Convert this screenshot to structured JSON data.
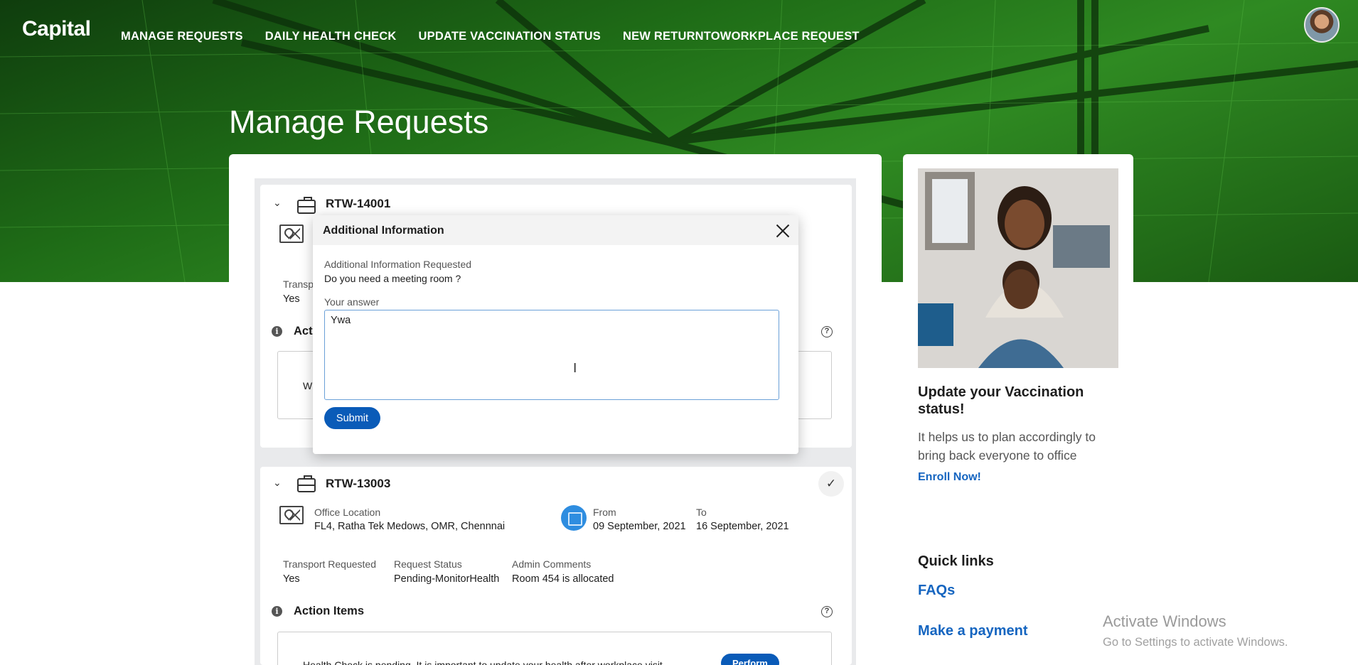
{
  "brand": {
    "logo": "Capital"
  },
  "nav": {
    "items": [
      "MANAGE REQUESTS",
      "DAILY HEALTH CHECK",
      "UPDATE VACCINATION STATUS",
      "NEW RETURNTOWORKPLACE REQUEST"
    ]
  },
  "page": {
    "title": "Manage Requests"
  },
  "requests": [
    {
      "id": "RTW-14001",
      "transport_label_partial": "Transp",
      "transport_value": "Yes",
      "action_items_partial": "Act",
      "action_text_partial": "W"
    },
    {
      "id": "RTW-13003",
      "office_location_label": "Office Location",
      "office_location": "FL4, Ratha Tek Medows, OMR, Chennnai",
      "from_label": "From",
      "from_date": "09 September, 2021",
      "to_label": "To",
      "to_date": "16 September, 2021",
      "transport_label": "Transport Requested",
      "transport_value": "Yes",
      "status_label": "Request Status",
      "status_value": "Pending-MonitorHealth",
      "admin_label": "Admin Comments",
      "admin_value": "Room 454 is allocated",
      "action_items_title": "Action Items",
      "health_text": "Health Check is pending. It is important to update your health after workplace visit",
      "perform_label": "Perform"
    }
  ],
  "modal": {
    "title": "Additional Information",
    "requested_label": "Additional Information Requested",
    "question": "Do you need a meeting room ?",
    "answer_label": "Your answer",
    "answer_value": "Ywa",
    "submit_label": "Submit"
  },
  "vaccination": {
    "title": "Update your Vaccination status!",
    "text": "It helps us to plan accordingly to bring back everyone to office",
    "link": "Enroll Now!"
  },
  "quick_links": {
    "title": "Quick links",
    "items": [
      "FAQs",
      "Make a payment"
    ]
  },
  "os_watermark": {
    "line1": "Activate Windows",
    "line2": "Go to Settings to activate Windows."
  },
  "colors": {
    "hero_green": "#1f6d17",
    "primary_blue": "#0a5bb8",
    "link_blue": "#1565c0"
  }
}
